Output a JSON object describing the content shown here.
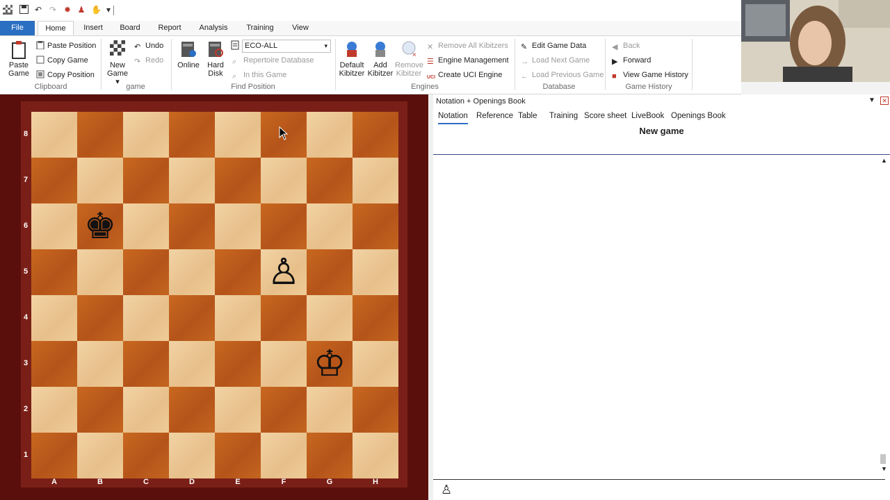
{
  "ribbon_tabs": [
    "File",
    "Home",
    "Insert",
    "Board",
    "Report",
    "Analysis",
    "Training",
    "View"
  ],
  "ribbon": {
    "paste_game": "Paste Game",
    "paste_game_line1": "Paste",
    "paste_game_line2": "Game",
    "paste_position": "Paste Position",
    "copy_game": "Copy Game",
    "copy_position": "Copy Position",
    "clipboard_label": "Clipboard",
    "new_game_line1": "New",
    "new_game_line2": "Game",
    "undo": "Undo",
    "redo": "Redo",
    "game_label": "game",
    "online": "Online",
    "hard_disk_line1": "Hard",
    "hard_disk_line2": "Disk",
    "eco_select": "ECO-ALL",
    "repertoire_database": "Repertoire Database",
    "in_this_game": "In this Game",
    "find_position_label": "Find Position",
    "default_kibitzer_line1": "Default",
    "default_kibitzer_line2": "Kibitzer",
    "add_kibitzer_line1": "Add",
    "add_kibitzer_line2": "Kibitzer",
    "remove_kibitzer_line1": "Remove",
    "remove_kibitzer_line2": "Kibitzer",
    "remove_all_kibitzers": "Remove All Kibitzers",
    "engine_management": "Engine Management",
    "create_uci_engine": "Create UCI Engine",
    "engines_label": "Engines",
    "edit_game_data": "Edit Game Data",
    "load_next_game": "Load Next Game",
    "load_previous_game": "Load Previous Game",
    "database_label": "Database",
    "back": "Back",
    "forward": "Forward",
    "view_game_history": "View Game History",
    "game_history_label": "Game History"
  },
  "board": {
    "ranks": [
      "8",
      "7",
      "6",
      "5",
      "4",
      "3",
      "2",
      "1"
    ],
    "files": [
      "A",
      "B",
      "C",
      "D",
      "E",
      "F",
      "G",
      "H"
    ],
    "pieces": [
      {
        "square": "b6",
        "glyph": "♚",
        "color": "black",
        "name": "black-king"
      },
      {
        "square": "f5",
        "glyph": "♙",
        "color": "white",
        "name": "white-pawn"
      },
      {
        "square": "g3",
        "glyph": "♔",
        "color": "white",
        "name": "white-king"
      }
    ]
  },
  "notation_panel": {
    "title": "Notation + Openings Book",
    "tabs": [
      "Notation",
      "Reference",
      "Table",
      "Training",
      "Score sheet",
      "LiveBook",
      "Openings Book"
    ],
    "active_tab": "Notation",
    "game_title": "New game",
    "side_to_move_glyph": "♙"
  },
  "colors": {
    "file_tab": "#2b6fc2",
    "board_light": "#f2d3a4",
    "board_dark": "#c8681f",
    "board_frame": "#7a1f17"
  }
}
